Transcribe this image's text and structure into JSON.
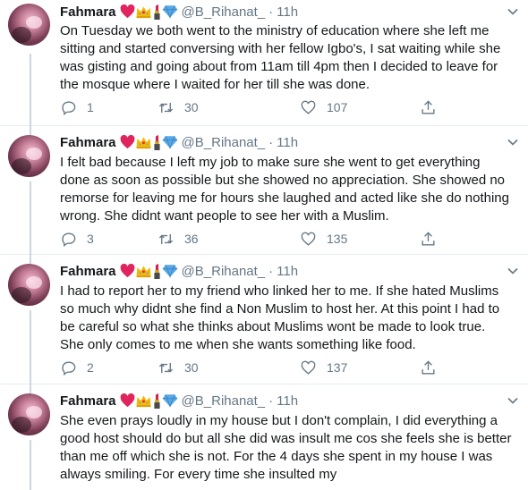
{
  "tweets": [
    {
      "name": "Fahmara",
      "handle": "@B_Rihanat_",
      "separator": "·",
      "time": "11h",
      "text": "On Tuesday we both went to the ministry of education where she left me sitting and started conversing with her fellow Igbo's, I sat waiting while she was gisting and going about from 11am till 4pm then I decided to leave for the mosque where I waited for her till she was done.",
      "replies": "1",
      "retweets": "30",
      "likes": "107"
    },
    {
      "name": "Fahmara",
      "handle": "@B_Rihanat_",
      "separator": "·",
      "time": "11h",
      "text": "I felt bad because I left my job to make sure she went to get everything done as soon as possible but she showed no appreciation. She showed no remorse for leaving me for hours she laughed and acted like she do nothing wrong. She didnt want people to see her with a Muslim.",
      "replies": "3",
      "retweets": "36",
      "likes": "135"
    },
    {
      "name": "Fahmara",
      "handle": "@B_Rihanat_",
      "separator": "·",
      "time": "11h",
      "text": "I had to report her to my friend who linked her to me. If she hated Muslims so much why didnt she find a Non Muslim to host her. At this point I had to be careful so what she thinks about Muslims wont be made to look true. She only comes to me when she wants something like food.",
      "replies": "2",
      "retweets": "30",
      "likes": "137"
    },
    {
      "name": "Fahmara",
      "handle": "@B_Rihanat_",
      "separator": "·",
      "time": "11h",
      "text": "She even prays loudly in my house but I don't complain, I did everything a good host should do but all she did was insult me cos she feels she is better than me off which she is not. For the 4 days she spent in my house I was always smiling. For every time she insulted my"
    }
  ],
  "name_emojis": [
    "red-heart-icon",
    "crown-icon",
    "lipstick-icon",
    "gem-icon"
  ],
  "colors": {
    "text": "#14171a",
    "muted": "#657786",
    "divider": "#e6ecf0",
    "thread_line": "#ccd6dd",
    "heart": "#e0245e",
    "crown": "#f5b800",
    "lipstick": "#d0234f",
    "gem": "#5aa9e6"
  }
}
